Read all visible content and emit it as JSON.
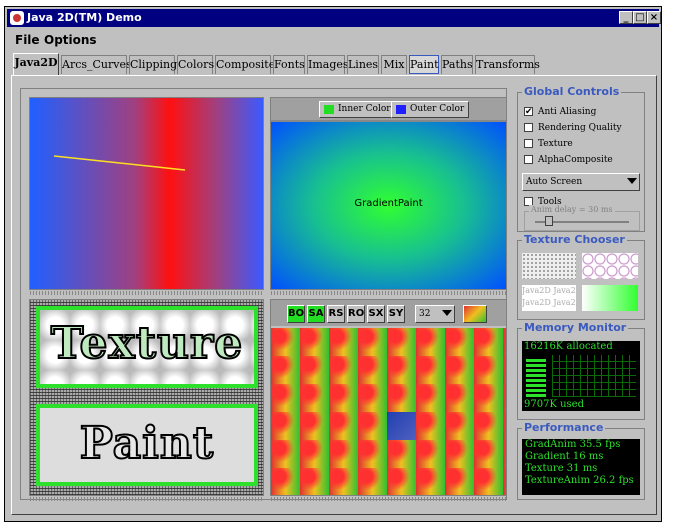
{
  "window": {
    "title": "Java 2D(TM) Demo",
    "minimize": "_",
    "maximize": "□",
    "close": "×"
  },
  "menu": {
    "file": "File",
    "options": "Options"
  },
  "tabs": [
    "Java2D",
    "Arcs_Curves",
    "Clipping",
    "Colors",
    "Composite",
    "Fonts",
    "Images",
    "Lines",
    "Mix",
    "Paint",
    "Paths",
    "Transforms"
  ],
  "gradient_panel": {
    "inner_label": "Inner Color",
    "outer_label": "Outer Color",
    "center_text": "GradientPaint",
    "inner_color": "#22dd22",
    "outer_color": "#2020ff"
  },
  "texture_panel": {
    "word1": "Texture",
    "word2": "Paint"
  },
  "checker_panel": {
    "buttons": [
      "BO",
      "SA",
      "RS",
      "RO",
      "SX",
      "SY"
    ],
    "active": [
      "BO",
      "SA"
    ],
    "size_value": "32"
  },
  "global_controls": {
    "title": "Global Controls",
    "anti_aliasing": "Anti Aliasing",
    "rendering_quality": "Rendering Quality",
    "texture": "Texture",
    "alpha_composite": "AlphaComposite",
    "screen_option": "Auto Screen",
    "tools": "Tools",
    "anim_delay": "Anim delay = 30 ms"
  },
  "texture_chooser": {
    "title": "Texture Chooser",
    "sample_text": "Java2D Java2",
    "sample_text2": "Java2D Java2"
  },
  "memory_monitor": {
    "title": "Memory Monitor",
    "allocated": "16216K allocated",
    "used": "9707K used"
  },
  "performance": {
    "title": "Performance",
    "lines": [
      "GradAnim 35.5 fps",
      "Gradient 16 ms",
      "Texture 31 ms",
      "TextureAnim 26.2 fps"
    ]
  }
}
